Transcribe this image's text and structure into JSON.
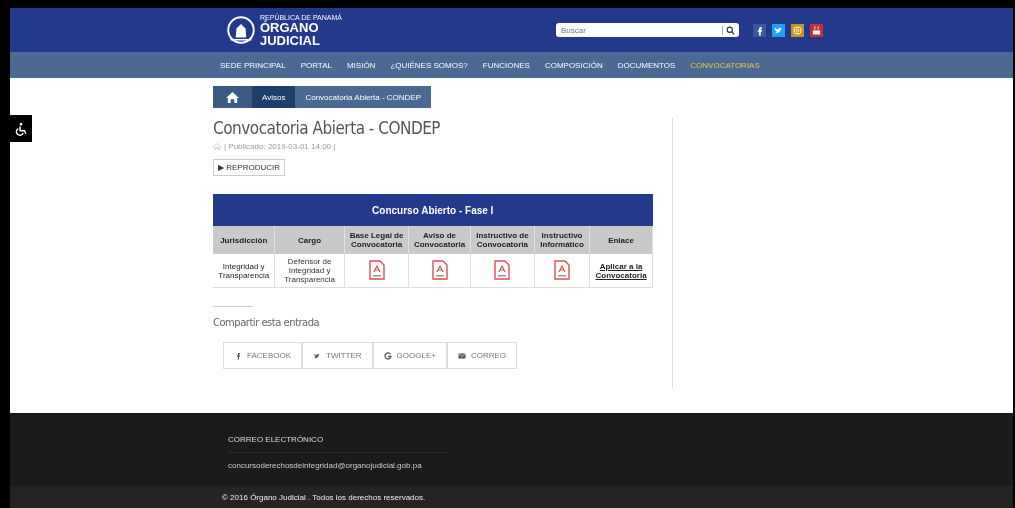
{
  "header": {
    "logo_top": "REPÚBLICA DE PANAMÁ",
    "logo_line1": "ÓRGANO",
    "logo_line2": "JUDICIAL",
    "search": {
      "placeholder": "Buscar"
    }
  },
  "nav": [
    {
      "label": "SEDE PRINCIPAL",
      "selected": false
    },
    {
      "label": "PORTAL",
      "selected": false
    },
    {
      "label": "MISIÓN",
      "selected": false
    },
    {
      "label": "¿QUIÉNES SOMOS?",
      "selected": false
    },
    {
      "label": "FUNCIONES",
      "selected": false
    },
    {
      "label": "COMPOSICIÓN",
      "selected": false
    },
    {
      "label": "DOCUMENTOS",
      "selected": false
    },
    {
      "label": "CONVOCATORIAS",
      "selected": true
    }
  ],
  "breadcrumb": [
    "Avisos",
    "Convocatoria Abierta - CONDEP"
  ],
  "article": {
    "title": "Convocatoria Abierta - CONDEP",
    "meta": "| Publicado: 2019-03-01 14:00 |",
    "play_button": "REPRODUCIR",
    "play_icon": "▶"
  },
  "table": {
    "title": "Concurso Abierto - Fase I",
    "columns": [
      "Jurisdicción",
      "Cargo",
      "Base Legal de Convocatoria",
      "Aviso de Convocatoria",
      "Instructivo de Convocatoria",
      "Instructivo Informático",
      "Enlace"
    ],
    "rows": [
      [
        {
          "kind": "text",
          "text": "Integridad y Transparencia"
        },
        {
          "kind": "text",
          "text": "Defensor de Integridad y Transparencia"
        },
        {
          "kind": "pdf"
        },
        {
          "kind": "pdf"
        },
        {
          "kind": "pdf"
        },
        {
          "kind": "pdf"
        },
        {
          "kind": "link",
          "text": "Aplicar a la Convocatoria"
        }
      ]
    ]
  },
  "share": {
    "title": "Compartir esta entrada",
    "buttons": [
      {
        "kind": "facebook",
        "label": "FACEBOOK"
      },
      {
        "kind": "twitter",
        "label": "TWITTER"
      },
      {
        "kind": "google",
        "label": "GOOGLE+"
      },
      {
        "kind": "mail",
        "label": "CORREO"
      }
    ]
  },
  "footer": {
    "heading": "CORREO ELECTRÓNICO",
    "email": "concursoderechosdeintegridad@organojudicial.gob.pa",
    "copyright": "© 2016 Órgano Judicial . Todos los derechos reservados."
  }
}
